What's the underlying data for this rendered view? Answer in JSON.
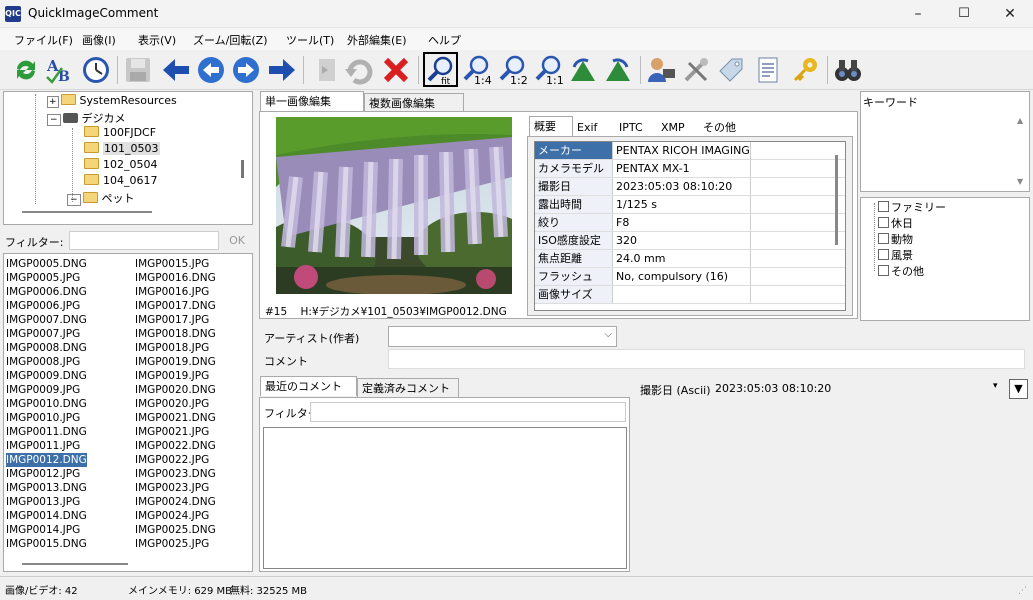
{
  "window": {
    "title": "QuickImageComment",
    "icon_text": "QIC",
    "minimize": "–",
    "maximize": "☐",
    "close": "✕"
  },
  "menu": [
    "ファイル(F)",
    "画像(I)",
    "表示(V)",
    "ズーム/回転(Z)",
    "ツール(T)",
    "外部編集(E)",
    "ヘルプ"
  ],
  "toolbar": {
    "zoom_fit": "fit",
    "zoom_14": "1:4",
    "zoom_12": "1:2",
    "zoom_11": "1:1"
  },
  "tree": {
    "items": [
      "SystemResources",
      "デジカメ",
      "100FJDCF",
      "101_0503",
      "102_0504",
      "104_0617",
      "ペット"
    ]
  },
  "filter": {
    "label": "フィルター:",
    "ok": "OK"
  },
  "files": {
    "col1": [
      "IMGP0005.DNG",
      "IMGP0005.JPG",
      "IMGP0006.DNG",
      "IMGP0006.JPG",
      "IMGP0007.DNG",
      "IMGP0007.JPG",
      "IMGP0008.DNG",
      "IMGP0008.JPG",
      "IMGP0009.DNG",
      "IMGP0009.JPG",
      "IMGP0010.DNG",
      "IMGP0010.JPG",
      "IMGP0011.DNG",
      "IMGP0011.JPG",
      "IMGP0012.DNG",
      "IMGP0012.JPG",
      "IMGP0013.DNG",
      "IMGP0013.JPG",
      "IMGP0014.DNG",
      "IMGP0014.JPG",
      "IMGP0015.DNG"
    ],
    "col2": [
      "IMGP0015.JPG",
      "IMGP0016.DNG",
      "IMGP0016.JPG",
      "IMGP0017.DNG",
      "IMGP0017.JPG",
      "IMGP0018.DNG",
      "IMGP0018.JPG",
      "IMGP0019.DNG",
      "IMGP0019.JPG",
      "IMGP0020.DNG",
      "IMGP0020.JPG",
      "IMGP0021.DNG",
      "IMGP0021.JPG",
      "IMGP0022.DNG",
      "IMGP0022.JPG",
      "IMGP0023.DNG",
      "IMGP0023.JPG",
      "IMGP0024.DNG",
      "IMGP0024.JPG",
      "IMGP0025.DNG",
      "IMGP0025.JPG"
    ],
    "selected": "IMGP0012.DNG"
  },
  "edit_tabs": [
    "単一画像編集",
    "複数画像編集"
  ],
  "image_caption": "#15    H:¥デジカメ¥101_0503¥IMGP0012.DNG",
  "meta_tabs": [
    "概要",
    "Exif",
    "IPTC",
    "XMP",
    "その他"
  ],
  "meta_rows": [
    [
      "メーカー",
      "PENTAX RICOH IMAGING"
    ],
    [
      "カメラモデル",
      "PENTAX MX-1"
    ],
    [
      "撮影日",
      "2023:05:03 08:10:20"
    ],
    [
      "露出時間",
      "1/125 s"
    ],
    [
      "絞り",
      "F8"
    ],
    [
      "ISO感度設定",
      "320"
    ],
    [
      "焦点距離",
      "24.0 mm"
    ],
    [
      "フラッシュ",
      "No, compulsory (16)"
    ],
    [
      "画像サイズ",
      ""
    ]
  ],
  "keywords": {
    "label": "キーワード",
    "items": [
      "ファミリー",
      "休日",
      "動物",
      "風景",
      "その他"
    ]
  },
  "artist": {
    "label": "アーティスト(作者)",
    "value": ""
  },
  "comment": {
    "label": "コメント",
    "value": ""
  },
  "comment_tabs": [
    "最近のコメント",
    "定義済みコメント"
  ],
  "comment_filter": {
    "label": "フィルター"
  },
  "date_field": {
    "label": "撮影日 (Ascii)",
    "value": "2023:05:03 08:10:20"
  },
  "status": {
    "images": "画像/ビデオ: 42",
    "memory": "メインメモリ: 629 MB",
    "free": "無料: 32525 MB"
  }
}
